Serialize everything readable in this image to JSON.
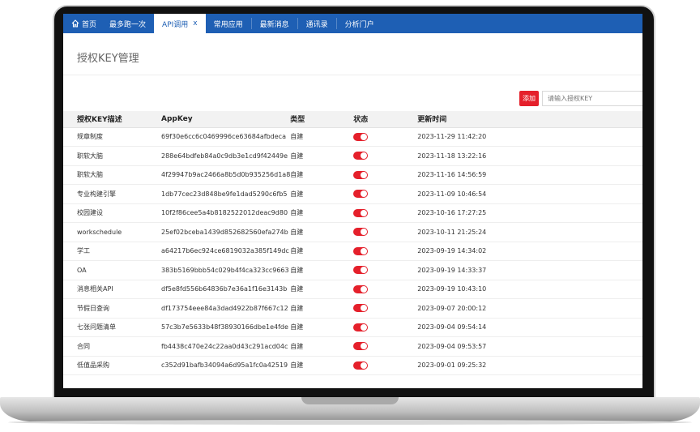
{
  "topnav": {
    "home_label": "首页",
    "tabs": [
      {
        "label": "最多跑一次",
        "active": false
      },
      {
        "label": "API调用",
        "active": true,
        "close": "x"
      },
      {
        "label": "常用应用",
        "active": false
      },
      {
        "label": "最新消息",
        "active": false
      },
      {
        "label": "通讯录",
        "active": false
      },
      {
        "label": "分析门户",
        "active": false
      }
    ]
  },
  "page": {
    "title": "授权KEY管理",
    "add_button": "添加",
    "search_placeholder": "请输入授权KEY"
  },
  "colors": {
    "nav": "#1e5fb4",
    "accent_red": "#e5202b"
  },
  "table": {
    "headers": {
      "desc": "授权KEY描述",
      "appkey": "AppKey",
      "type": "类型",
      "status": "状态",
      "time": "更新时间"
    },
    "rows": [
      {
        "desc": "规章制度",
        "appkey": "69f30e6cc6c0469996ce63684afbdeca",
        "type": "自建",
        "status_on": true,
        "time": "2023-11-29 11:42:20"
      },
      {
        "desc": "职软大脑",
        "appkey": "288e64bdfeb84a0c9db3e1cd9f42449e",
        "type": "自建",
        "status_on": true,
        "time": "2023-11-18 13:22:16"
      },
      {
        "desc": "职软大脑",
        "appkey": "4f29947b9ac2466a8b5d0b935256d1a8",
        "type": "自建",
        "status_on": true,
        "time": "2023-11-16 14:56:59"
      },
      {
        "desc": "专业构建引擎",
        "appkey": "1db77cec23d848be9fe1dad5290c6fb5",
        "type": "自建",
        "status_on": true,
        "time": "2023-11-09 10:46:54"
      },
      {
        "desc": "校园建设",
        "appkey": "10f2f86cee5a4b8182522012deac9d80",
        "type": "自建",
        "status_on": true,
        "time": "2023-10-16 17:27:25"
      },
      {
        "desc": "workschedule",
        "appkey": "25ef02bceba1439d852682560efa274b",
        "type": "自建",
        "status_on": true,
        "time": "2023-10-11 21:25:24"
      },
      {
        "desc": "学工",
        "appkey": "a64217b6ec924ce6819032a385f149dc",
        "type": "自建",
        "status_on": true,
        "time": "2023-09-19 14:34:02"
      },
      {
        "desc": "OA",
        "appkey": "383b5169bbb54c029b4f4ca323cc9663",
        "type": "自建",
        "status_on": true,
        "time": "2023-09-19 14:33:37"
      },
      {
        "desc": "消息相关API",
        "appkey": "df5e8fd556b64836b7e36a1f16e3143b",
        "type": "自建",
        "status_on": true,
        "time": "2023-09-19 10:43:10"
      },
      {
        "desc": "节假日查询",
        "appkey": "df173754eee84a3dad4922b87f667c12",
        "type": "自建",
        "status_on": true,
        "time": "2023-09-07 20:00:12"
      },
      {
        "desc": "七张问题清单",
        "appkey": "57c3b7e5633b48f38930166dbe1e4fde",
        "type": "自建",
        "status_on": true,
        "time": "2023-09-04 09:54:14"
      },
      {
        "desc": "合同",
        "appkey": "fb4438c470e24c22aa0d43c291acd04c",
        "type": "自建",
        "status_on": true,
        "time": "2023-09-04 09:53:57"
      },
      {
        "desc": "低值品采购",
        "appkey": "c352d91bafb34094a6d95a1fc0a42519",
        "type": "自建",
        "status_on": true,
        "time": "2023-09-01 09:25:32"
      }
    ]
  }
}
